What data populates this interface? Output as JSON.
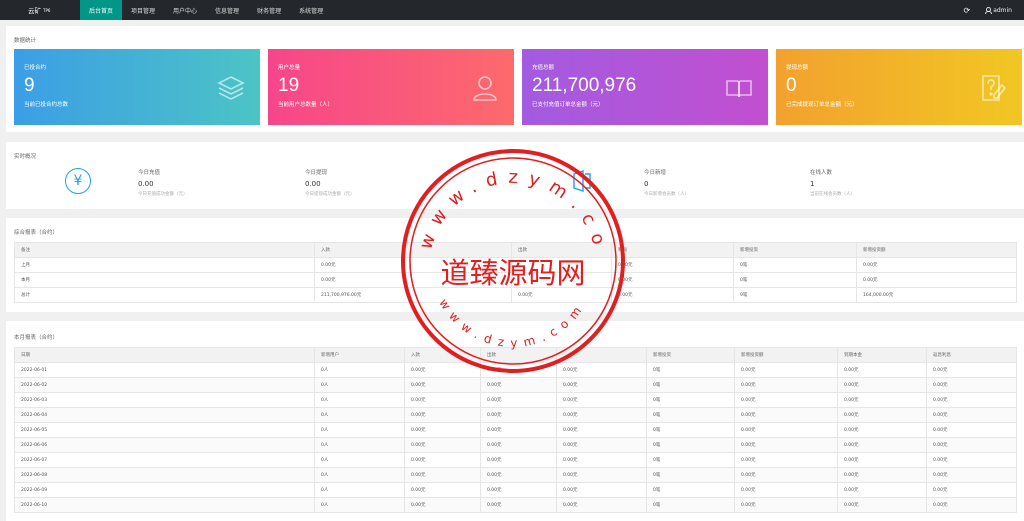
{
  "topbar": {
    "logo": "云矿",
    "logo_sup": "TP6",
    "nav": [
      "后台首页",
      "项目管理",
      "用户中心",
      "信息管理",
      "财务管理",
      "系统管理"
    ],
    "active_index": 0,
    "refresh_icon": "refresh-icon",
    "admin": "admin"
  },
  "stats": {
    "title": "数据统计",
    "cards": [
      {
        "label": "已投合约",
        "value": "9",
        "sub": "当前已投合约总数",
        "icon": "layers-icon",
        "color": "#3c9ee6"
      },
      {
        "label": "用户总量",
        "value": "19",
        "sub": "当前用户总数量（人）",
        "icon": "users-icon",
        "color": "#f6468b"
      },
      {
        "label": "充值总额",
        "value": "211,700,976",
        "sub": "已支付充值订单总金额（元）",
        "icon": "book-icon",
        "color": "#a35be0"
      },
      {
        "label": "提现总额",
        "value": "0",
        "sub": "已完成提现订单总金额（元）",
        "icon": "note-question-icon",
        "color": "#f3a12e"
      }
    ]
  },
  "realtime": {
    "title": "实时概况",
    "items": [
      {
        "label": "今日充值",
        "value": "0.00",
        "sub": "今日充值成功金额（元）"
      },
      {
        "label": "今日提现",
        "value": "0.00",
        "sub": "今日提现成功金额（元）"
      },
      {
        "label": "今日新增",
        "value": "0",
        "sub": "今日新增会员数（人）"
      },
      {
        "label": "在线人数",
        "value": "1",
        "sub": "当前在线会员数（人）"
      }
    ]
  },
  "summary": {
    "title": "综合报表（合约）",
    "columns": [
      "备注",
      "入款",
      "出款",
      "利润",
      "新增投资",
      "新增投资额"
    ],
    "rows": [
      [
        "上月",
        "0.00元",
        "",
        "0.00元",
        "0笔",
        "0.00元"
      ],
      [
        "本月",
        "0.00元",
        "",
        "0.00元",
        "0笔",
        "0.00元"
      ],
      [
        "总计",
        "211,700,976.00元",
        "0.00元",
        "0.00元",
        "9笔",
        "164,000.00元"
      ]
    ]
  },
  "monthly": {
    "title": "本月报表（合约）",
    "columns": [
      "日期",
      "新增用户",
      "入款",
      "出款",
      "",
      "新增投资",
      "新增投资额",
      "到期本金",
      "返息利息"
    ],
    "rows": [
      [
        "2022-06-01",
        "0人",
        "0.00元",
        "0.00元",
        "0.00元",
        "0笔",
        "0.00元",
        "0.00元",
        "0.00元"
      ],
      [
        "2022-06-02",
        "0人",
        "0.00元",
        "0.00元",
        "0.00元",
        "0笔",
        "0.00元",
        "0.00元",
        "0.00元"
      ],
      [
        "2022-06-03",
        "0人",
        "0.00元",
        "0.00元",
        "0.00元",
        "0笔",
        "0.00元",
        "0.00元",
        "0.00元"
      ],
      [
        "2022-06-04",
        "0人",
        "0.00元",
        "0.00元",
        "0.00元",
        "0笔",
        "0.00元",
        "0.00元",
        "0.00元"
      ],
      [
        "2022-06-05",
        "0人",
        "0.00元",
        "0.00元",
        "0.00元",
        "0笔",
        "0.00元",
        "0.00元",
        "0.00元"
      ],
      [
        "2022-06-06",
        "0人",
        "0.00元",
        "0.00元",
        "0.00元",
        "0笔",
        "0.00元",
        "0.00元",
        "0.00元"
      ],
      [
        "2022-06-07",
        "0人",
        "0.00元",
        "0.00元",
        "0.00元",
        "0笔",
        "0.00元",
        "0.00元",
        "0.00元"
      ],
      [
        "2022-06-08",
        "0人",
        "0.00元",
        "0.00元",
        "0.00元",
        "0笔",
        "0.00元",
        "0.00元",
        "0.00元"
      ],
      [
        "2022-06-09",
        "0人",
        "0.00元",
        "0.00元",
        "0.00元",
        "0笔",
        "0.00元",
        "0.00元",
        "0.00元"
      ],
      [
        "2022-06-10",
        "0人",
        "0.00元",
        "0.00元",
        "0.00元",
        "0笔",
        "0.00元",
        "0.00元",
        "0.00元"
      ]
    ]
  },
  "watermark": {
    "text": "道臻源码网",
    "url": "www.dzym.com",
    "color": "#e02020"
  }
}
